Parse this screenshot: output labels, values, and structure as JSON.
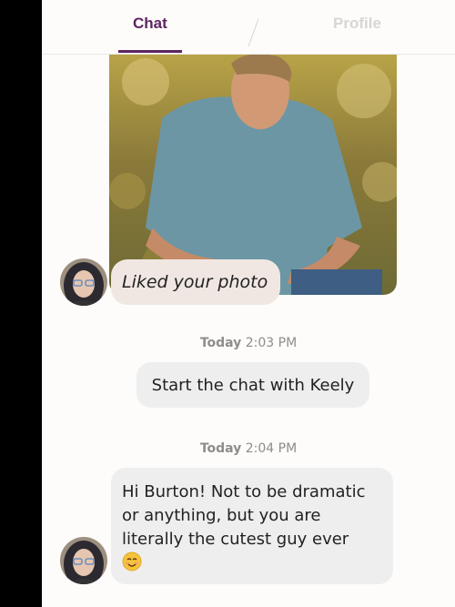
{
  "tabs": {
    "chat": "Chat",
    "profile": "Profile",
    "active": "Chat"
  },
  "liked_photo": {
    "label": "Liked your photo"
  },
  "timestamps": [
    {
      "day": "Today",
      "time": "2:03 PM"
    },
    {
      "day": "Today",
      "time": "2:04 PM"
    }
  ],
  "messages": {
    "start_chat": "Start the chat with Keely",
    "first_message": "Hi Burton! Not to be dramatic or anything, but you are literally the cutest guy ever"
  },
  "colors": {
    "accent": "#5d2561",
    "liked_bubble": "#f1e7e2",
    "message_bubble": "#eeeeee",
    "timestamp": "#8f8c8a"
  },
  "icons": {
    "emoji": "smiling-face-icon"
  }
}
